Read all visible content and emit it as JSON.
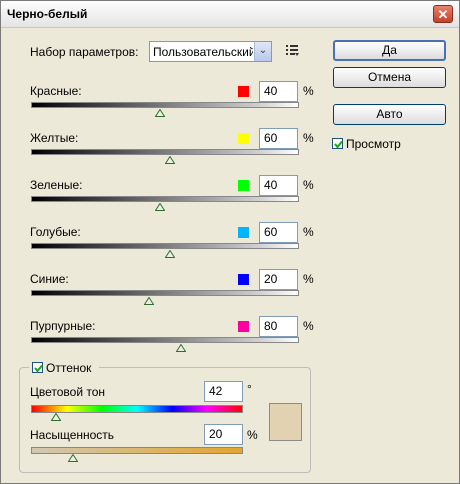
{
  "window": {
    "title": "Черно-белый",
    "close_glyph": "✕"
  },
  "preset": {
    "label": "Набор параметров:",
    "value": "Пользовательский",
    "arrow_glyph": "⌄",
    "menu_icon": "list-menu-icon"
  },
  "buttons": {
    "ok": "Да",
    "cancel": "Отмена",
    "auto": "Авто"
  },
  "preview": {
    "label": "Просмотр",
    "checked": true
  },
  "percent_sign": "%",
  "degree_sign": "°",
  "colors": [
    {
      "label": "Красные:",
      "value": "40",
      "swatch": "#ff0000",
      "min": -200,
      "max": 300
    },
    {
      "label": "Желтые:",
      "value": "60",
      "swatch": "#ffff00",
      "min": -200,
      "max": 300
    },
    {
      "label": "Зеленые:",
      "value": "40",
      "swatch": "#00ff00",
      "min": -200,
      "max": 300
    },
    {
      "label": "Голубые:",
      "value": "60",
      "swatch": "#00b4ff",
      "min": -200,
      "max": 300
    },
    {
      "label": "Синие:",
      "value": "20",
      "swatch": "#0000ff",
      "min": -200,
      "max": 300
    },
    {
      "label": "Пурпурные:",
      "value": "80",
      "swatch": "#ff00a0",
      "min": -200,
      "max": 300
    }
  ],
  "tint": {
    "label": "Оттенок",
    "checked": true,
    "hue_label": "Цветовой тон",
    "hue_value": "42",
    "hue_max": 360,
    "saturation_label": "Насыщенность",
    "saturation_value": "20",
    "saturation_max": 100,
    "preview_color": "#e3d2b2"
  }
}
